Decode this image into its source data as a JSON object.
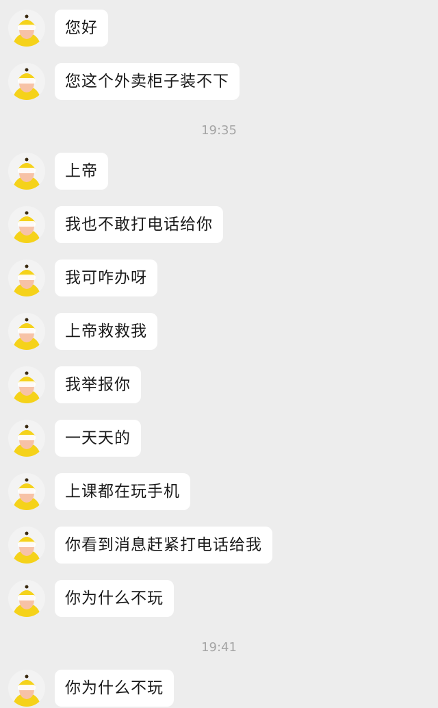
{
  "messages": [
    {
      "text": "您好"
    },
    {
      "text": "您这个外卖柜子装不下"
    },
    {
      "text": "上帝"
    },
    {
      "text": "我也不敢打电话给你"
    },
    {
      "text": "我可咋办呀"
    },
    {
      "text": "上帝救救我"
    },
    {
      "text": "我举报你"
    },
    {
      "text": "一天天的"
    },
    {
      "text": "上课都在玩手机"
    },
    {
      "text": "你看到消息赶紧打电话给我"
    },
    {
      "text": "你为什么不玩"
    },
    {
      "text": "你为什么不玩"
    }
  ],
  "timestamps": [
    "19:35",
    "19:41"
  ],
  "avatar_icon": "cartoon-avatar-icon",
  "colors": {
    "background": "#ededed",
    "bubble": "#ffffff",
    "avatar_yellow": "#f5d21a",
    "time_text": "#a5a5a5"
  }
}
